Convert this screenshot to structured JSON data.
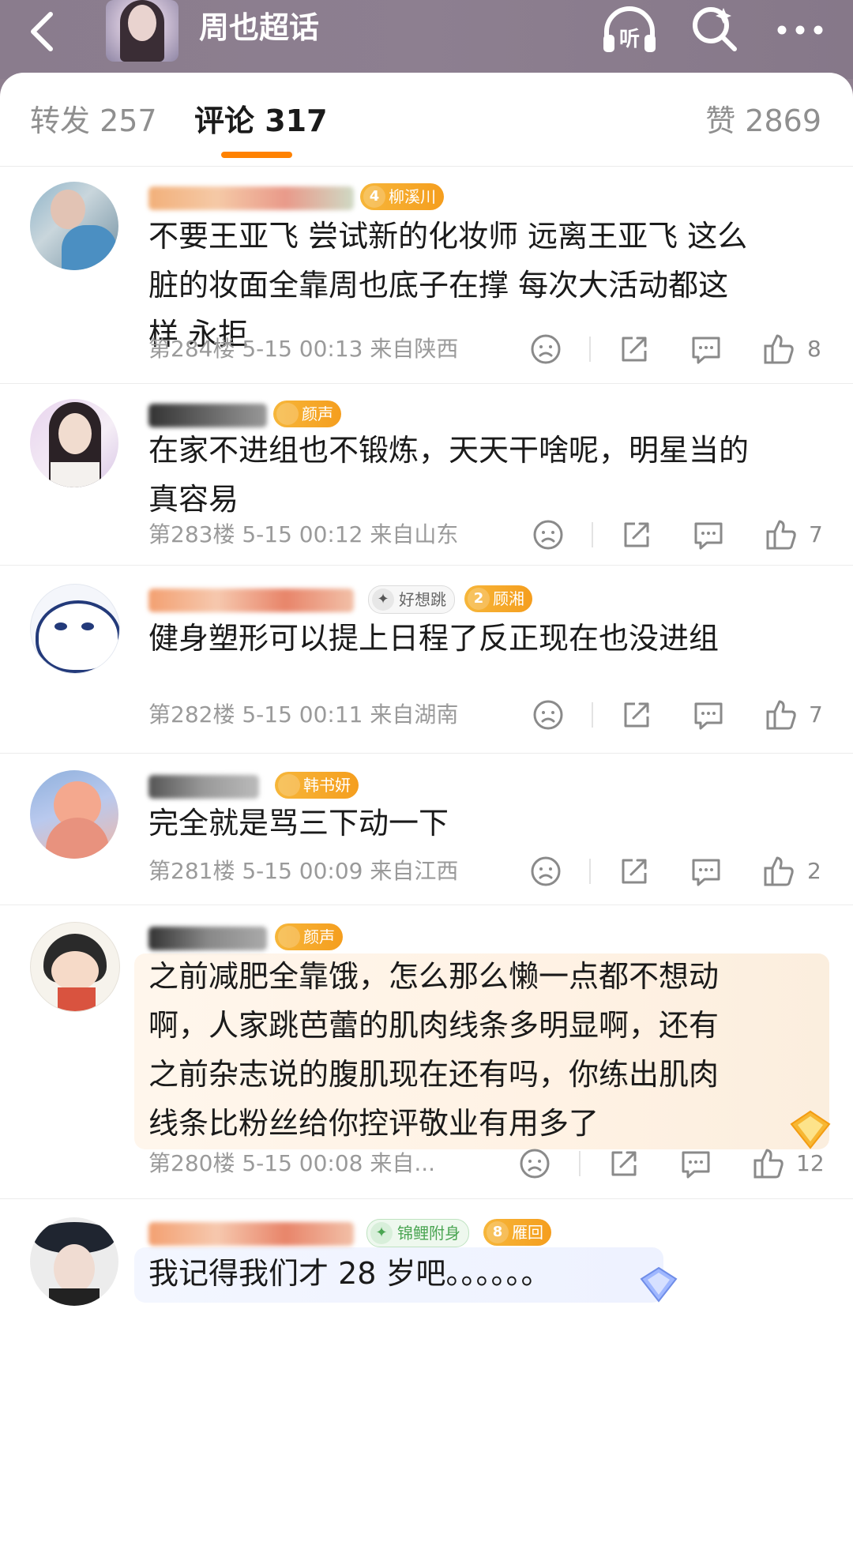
{
  "header": {
    "title": "周也超话"
  },
  "tabs": {
    "repost": "转发 257",
    "comment": "评论 317",
    "like": "赞 2869"
  },
  "comments": [
    {
      "badges": [
        {
          "num": "4",
          "label": "柳溪川"
        }
      ],
      "text": "不要王亚飞 尝试新的化妆师 远离王亚飞 这么\n脏的妆面全靠周也底子在撑 每次大活动都这\n样 永拒",
      "meta": "第284楼 5-15 00:13 来自陕西",
      "likes": "8"
    },
    {
      "badges": [
        {
          "num": "",
          "label": "颜声"
        }
      ],
      "text": "在家不进组也不锻炼，天天干啥呢，明星当的\n真容易",
      "meta": "第283楼 5-15 00:12 来自山东",
      "likes": "7"
    },
    {
      "badges": [
        {
          "num": "",
          "label": "好想跳"
        },
        {
          "num": "2",
          "label": "顾湘"
        }
      ],
      "text": "健身塑形可以提上日程了反正现在也没进组",
      "meta": "第282楼 5-15 00:11 来自湖南",
      "likes": "7"
    },
    {
      "badges": [
        {
          "num": "",
          "label": "韩书妍"
        }
      ],
      "text": "完全就是骂三下动一下",
      "meta": "第281楼 5-15 00:09 来自江西",
      "likes": "2"
    },
    {
      "badges": [
        {
          "num": "",
          "label": "颜声"
        }
      ],
      "text": "之前减肥全靠饿，怎么那么懒一点都不想动\n啊，人家跳芭蕾的肌肉线条多明显啊，还有\n之前杂志说的腹肌现在还有吗，你练出肌肉\n线条比粉丝给你控评敬业有用多了",
      "meta": "第280楼 5-15 00:08 来自...",
      "likes": "12"
    },
    {
      "badges": [
        {
          "num": "",
          "label": "锦鲤附身"
        },
        {
          "num": "8",
          "label": "雁回"
        }
      ],
      "text": "我记得我们才 28 岁吧。。。。。。",
      "meta": "",
      "likes": ""
    }
  ],
  "colors": {
    "accent": "#ff8200",
    "badge_gold": "#f5a623"
  },
  "icons": [
    "back-arrow-icon",
    "listen-icon",
    "search-icon",
    "more-icon",
    "dislike-icon",
    "share-icon",
    "comment-icon",
    "like-icon"
  ]
}
